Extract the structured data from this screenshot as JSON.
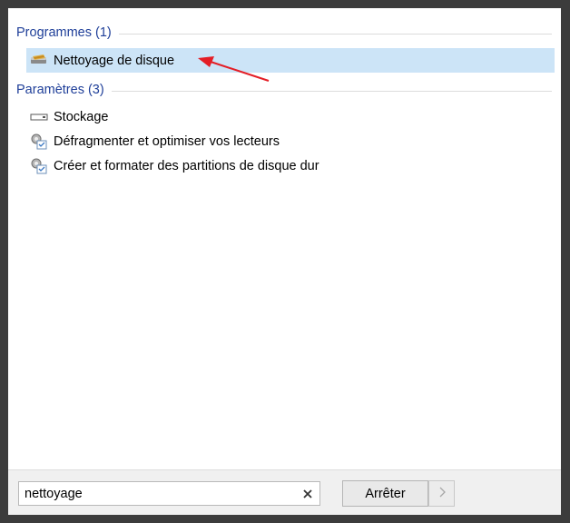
{
  "groups": [
    {
      "label": "Programmes (1)",
      "items": [
        {
          "label": "Nettoyage de disque",
          "icon": "disk-cleanup-icon"
        }
      ]
    },
    {
      "label": "Paramètres (3)",
      "items": [
        {
          "label": "Stockage",
          "icon": "drive-icon"
        },
        {
          "label": "Défragmenter et optimiser vos lecteurs",
          "icon": "settings-icon"
        },
        {
          "label": "Créer et formater des partitions de disque dur",
          "icon": "settings-icon"
        }
      ]
    }
  ],
  "search": {
    "value": "nettoyage"
  },
  "buttons": {
    "stop_label": "Arrêter"
  },
  "colors": {
    "header_text": "#1f3f99",
    "selected_bg": "#cce4f7",
    "annotation_arrow": "#e41e26"
  }
}
